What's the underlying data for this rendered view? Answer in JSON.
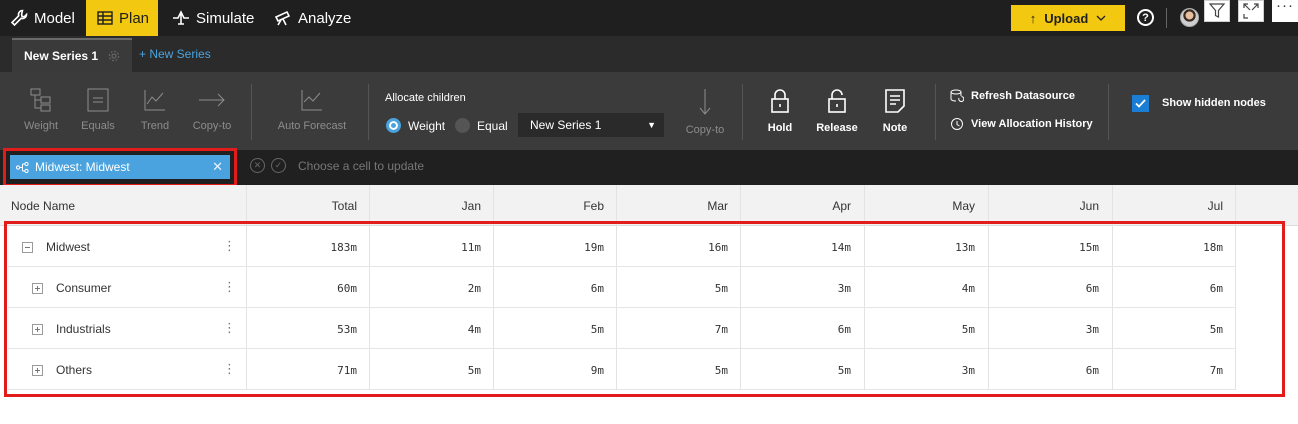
{
  "nav": {
    "model": "Model",
    "plan": "Plan",
    "simulate": "Simulate",
    "analyze": "Analyze",
    "upload": "Upload"
  },
  "tabs": {
    "active": "New Series 1",
    "add": "+ New Series"
  },
  "toolbar": {
    "weight": "Weight",
    "equals": "Equals",
    "trend": "Trend",
    "copy_to": "Copy-to",
    "auto_forecast": "Auto Forecast",
    "allocate_title": "Allocate children",
    "radio_weight": "Weight",
    "radio_equal": "Equal",
    "series_select": "New Series 1",
    "copy_to_2": "Copy-to",
    "hold": "Hold",
    "release": "Release",
    "note": "Note",
    "refresh": "Refresh Datasource",
    "view_history": "View Allocation History",
    "show_hidden": "Show hidden nodes",
    "show_hidden_checked": true
  },
  "filter": {
    "chip": "Midwest: Midwest",
    "prompt": "Choose a cell to update"
  },
  "grid": {
    "columns": [
      "Node Name",
      "Total",
      "Jan",
      "Feb",
      "Mar",
      "Apr",
      "May",
      "Jun",
      "Jul"
    ],
    "rows": [
      {
        "name": "Midwest",
        "expanded": true,
        "values": [
          "183m",
          "11m",
          "19m",
          "16m",
          "14m",
          "13m",
          "15m",
          "18m"
        ]
      },
      {
        "name": "Consumer",
        "expanded": false,
        "values": [
          "60m",
          "2m",
          "6m",
          "5m",
          "3m",
          "4m",
          "6m",
          "6m"
        ]
      },
      {
        "name": "Industrials",
        "expanded": false,
        "values": [
          "53m",
          "4m",
          "5m",
          "7m",
          "6m",
          "5m",
          "3m",
          "5m"
        ]
      },
      {
        "name": "Others",
        "expanded": false,
        "values": [
          "71m",
          "5m",
          "9m",
          "5m",
          "5m",
          "3m",
          "6m",
          "7m"
        ]
      }
    ]
  },
  "colors": {
    "accent": "#f2c811",
    "chip": "#4aa3df",
    "highlight": "#e21b1b",
    "checkbox": "#1a7fd4"
  }
}
